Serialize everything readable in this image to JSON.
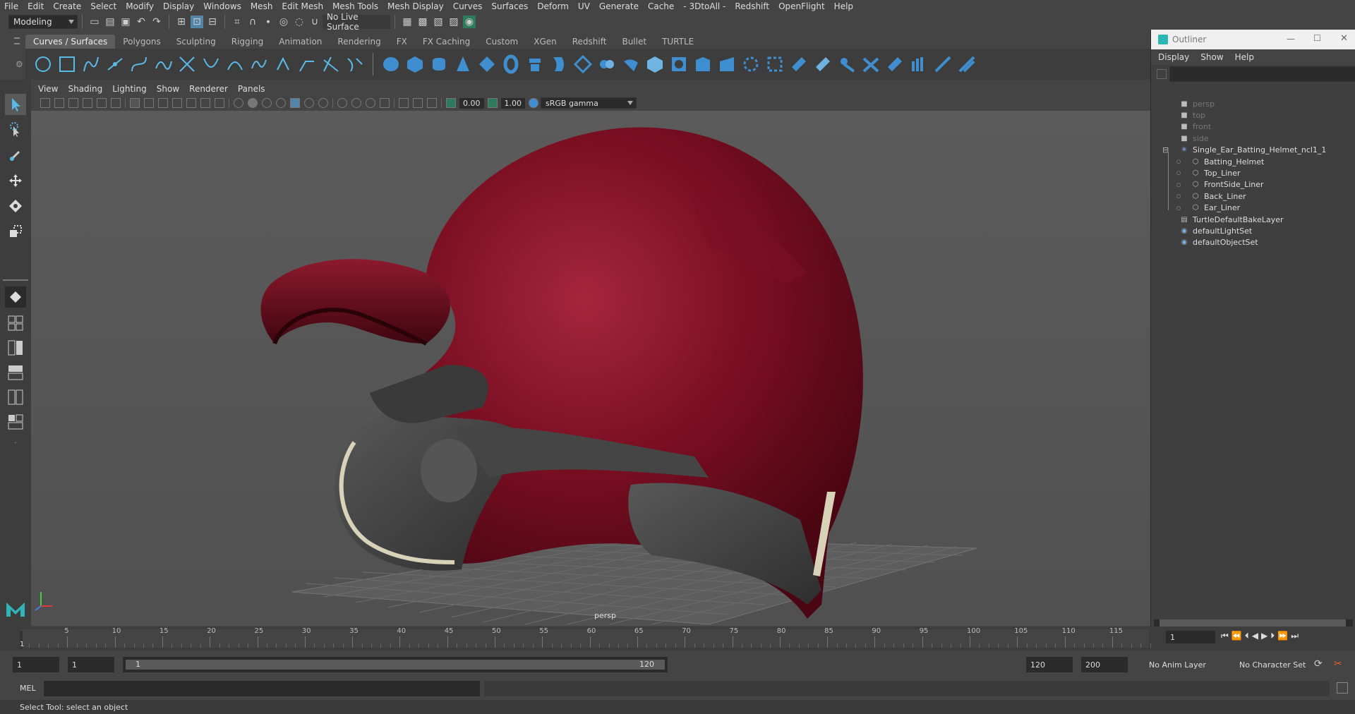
{
  "menubar": [
    "File",
    "Edit",
    "Create",
    "Select",
    "Modify",
    "Display",
    "Windows",
    "Mesh",
    "Edit Mesh",
    "Mesh Tools",
    "Mesh Display",
    "Curves",
    "Surfaces",
    "Deform",
    "UV",
    "Generate",
    "Cache",
    "- 3DtoAll -",
    "Redshift",
    "OpenFlight",
    "Help"
  ],
  "toolbar": {
    "mode": "Modeling",
    "live_surface": "No Live Surface"
  },
  "shelf_tabs": [
    "Curves / Surfaces",
    "Polygons",
    "Sculpting",
    "Rigging",
    "Animation",
    "Rendering",
    "FX",
    "FX Caching",
    "Custom",
    "XGen",
    "Redshift",
    "Bullet",
    "TURTLE"
  ],
  "panel_menu": [
    "View",
    "Shading",
    "Lighting",
    "Show",
    "Renderer",
    "Panels"
  ],
  "panel_toolbar": {
    "exposure": "0.00",
    "gamma": "1.00",
    "color_space": "sRGB gamma"
  },
  "viewport": {
    "camera_label": "persp"
  },
  "outliner": {
    "title": "Outliner",
    "menu": [
      "Display",
      "Show",
      "Help"
    ],
    "items": [
      {
        "label": "persp",
        "dim": true,
        "indent": 1,
        "icon": "camera-icon"
      },
      {
        "label": "top",
        "dim": true,
        "indent": 1,
        "icon": "camera-icon"
      },
      {
        "label": "front",
        "dim": true,
        "indent": 1,
        "icon": "camera-icon"
      },
      {
        "label": "side",
        "dim": true,
        "indent": 1,
        "icon": "camera-icon"
      },
      {
        "label": "Single_Ear_Batting_Helmet_ncl1_1",
        "dim": false,
        "indent": 1,
        "icon": "group-icon",
        "expanded": true
      },
      {
        "label": "Batting_Helmet",
        "dim": false,
        "indent": 2,
        "icon": "mesh-icon"
      },
      {
        "label": "Top_Liner",
        "dim": false,
        "indent": 2,
        "icon": "mesh-icon"
      },
      {
        "label": "FrontSide_Liner",
        "dim": false,
        "indent": 2,
        "icon": "mesh-icon"
      },
      {
        "label": "Back_Liner",
        "dim": false,
        "indent": 2,
        "icon": "mesh-icon"
      },
      {
        "label": "Ear_Liner",
        "dim": false,
        "indent": 2,
        "icon": "mesh-icon"
      },
      {
        "label": "TurtleDefaultBakeLayer",
        "dim": false,
        "indent": 1,
        "icon": "layer-icon"
      },
      {
        "label": "defaultLightSet",
        "dim": false,
        "indent": 1,
        "icon": "set-icon"
      },
      {
        "label": "defaultObjectSet",
        "dim": false,
        "indent": 1,
        "icon": "set-icon"
      }
    ]
  },
  "timeline": {
    "ticks": [
      "5",
      "10",
      "15",
      "20",
      "25",
      "30",
      "35",
      "40",
      "45",
      "50",
      "55",
      "60",
      "65",
      "70",
      "75",
      "80",
      "85",
      "90",
      "95",
      "100",
      "105",
      "110",
      "115"
    ],
    "current_frame_marker": "1",
    "current_frame": "1"
  },
  "range": {
    "start": "1",
    "playback_start": "1",
    "slider_start": "1",
    "slider_end": "120",
    "playback_end": "120",
    "end": "200",
    "anim_layer": "No Anim Layer",
    "character_set": "No Character Set"
  },
  "cmdline": {
    "label": "MEL"
  },
  "status": {
    "text": "Select Tool: select an object"
  }
}
